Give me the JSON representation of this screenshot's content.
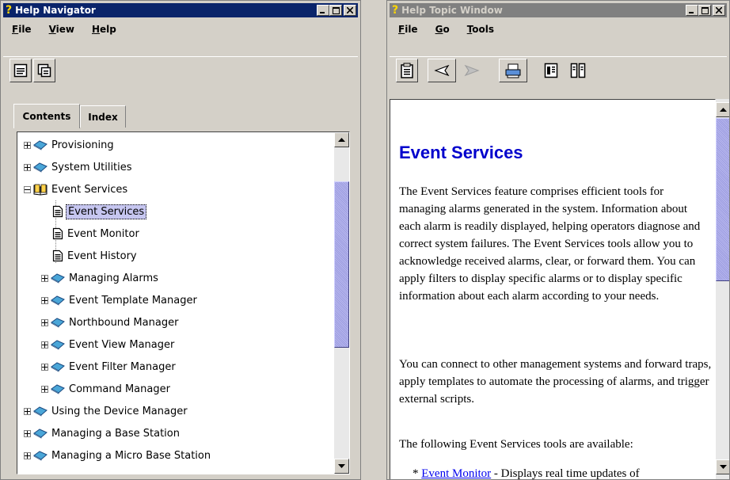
{
  "nav_window": {
    "title": "Help Navigator",
    "menu": [
      {
        "pre": "",
        "u": "F",
        "post": "ile"
      },
      {
        "pre": "",
        "u": "V",
        "post": "iew"
      },
      {
        "pre": "",
        "u": "H",
        "post": "elp"
      }
    ],
    "tabs": {
      "contents": "Contents",
      "index": "Index"
    },
    "tree": [
      {
        "label": "Provisioning",
        "level": 0,
        "type": "book"
      },
      {
        "label": "System Utilities",
        "level": 0,
        "type": "book"
      },
      {
        "label": "Event Services",
        "level": 0,
        "type": "openbook"
      },
      {
        "label": "Event Services",
        "level": 1,
        "type": "page",
        "selected": true
      },
      {
        "label": "Event Monitor",
        "level": 1,
        "type": "page"
      },
      {
        "label": "Event History",
        "level": 1,
        "type": "page"
      },
      {
        "label": "Managing Alarms",
        "level": 1,
        "type": "book"
      },
      {
        "label": "Event Template Manager",
        "level": 1,
        "type": "book"
      },
      {
        "label": "Northbound Manager",
        "level": 1,
        "type": "book"
      },
      {
        "label": "Event View Manager",
        "level": 1,
        "type": "book"
      },
      {
        "label": "Event Filter Manager",
        "level": 1,
        "type": "book"
      },
      {
        "label": "Command Manager",
        "level": 1,
        "type": "book"
      },
      {
        "label": "Using the Device Manager",
        "level": 0,
        "type": "book"
      },
      {
        "label": "Managing a Base Station",
        "level": 0,
        "type": "book"
      },
      {
        "label": "Managing a Micro Base Station",
        "level": 0,
        "type": "book"
      }
    ]
  },
  "topic_window": {
    "title": "Help Topic Window",
    "menu": [
      {
        "pre": "",
        "u": "F",
        "post": "ile"
      },
      {
        "pre": "",
        "u": "G",
        "post": "o"
      },
      {
        "pre": "",
        "u": "T",
        "post": "ools"
      }
    ],
    "heading": "Event Services",
    "paragraphs": [
      "The Event Services feature comprises efficient tools for managing alarms generated in the system. Information about each alarm is readily displayed, helping operators diagnose and correct system failures. The Event Services tools allow you to acknowledge received alarms, clear, or forward them. You can apply filters to display specific alarms or to display specific information about each alarm according to your needs.",
      "You can connect to other management systems and forward traps, apply templates to automate the processing of alarms, and trigger external scripts.",
      "The following Event Services tools are available:"
    ],
    "list_item": {
      "bullet": "*",
      "link": "Event Monitor",
      "text": " - Displays real time updates of"
    }
  },
  "icons": {
    "book": "closed-book-icon",
    "openbook": "open-book-icon",
    "page": "page-icon"
  },
  "colors": {
    "active_title": "#0a246a",
    "inactive_title": "#808080",
    "heading": "#0000cc",
    "link": "#0000ee",
    "selection": "#c6c6f0",
    "thumb": "#9c9ce0"
  }
}
